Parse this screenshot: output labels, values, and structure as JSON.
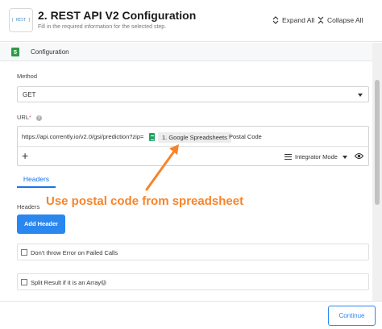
{
  "header": {
    "logo_text": "{ REST }",
    "title": "2. REST API V2 Configuration",
    "subtitle": "Fill in the required information for the selected step.",
    "expand_all": "Expand All",
    "collapse_all": "Collapse All"
  },
  "section": {
    "step_number": "5",
    "label": "Configuration"
  },
  "method": {
    "label": "Method",
    "value": "GET"
  },
  "url": {
    "label": "URL",
    "required_mark": "*",
    "text": "https://api.corrently.io/v2.0/gsi/prediction?zip=",
    "chip_label": "1. Google Spreadsheets",
    "chip_field": "Postal Code",
    "add_symbol": "+",
    "integrator_mode": "Integrator Mode"
  },
  "tabs": {
    "headers": "Headers"
  },
  "annotation": {
    "text": "Use postal code from spreadsheet",
    "color": "#f7842a"
  },
  "headers_section": {
    "label": "Headers",
    "add_button": "Add Header"
  },
  "options": {
    "dont_throw_error": "Don't throw Error on Failed Calls",
    "split_result": "Split Result if it is an Array"
  },
  "footer": {
    "continue": "Continue"
  },
  "colors": {
    "accent": "#2b87f0",
    "step_badge": "#2e9a46",
    "sheets_green": "#1ea362"
  }
}
